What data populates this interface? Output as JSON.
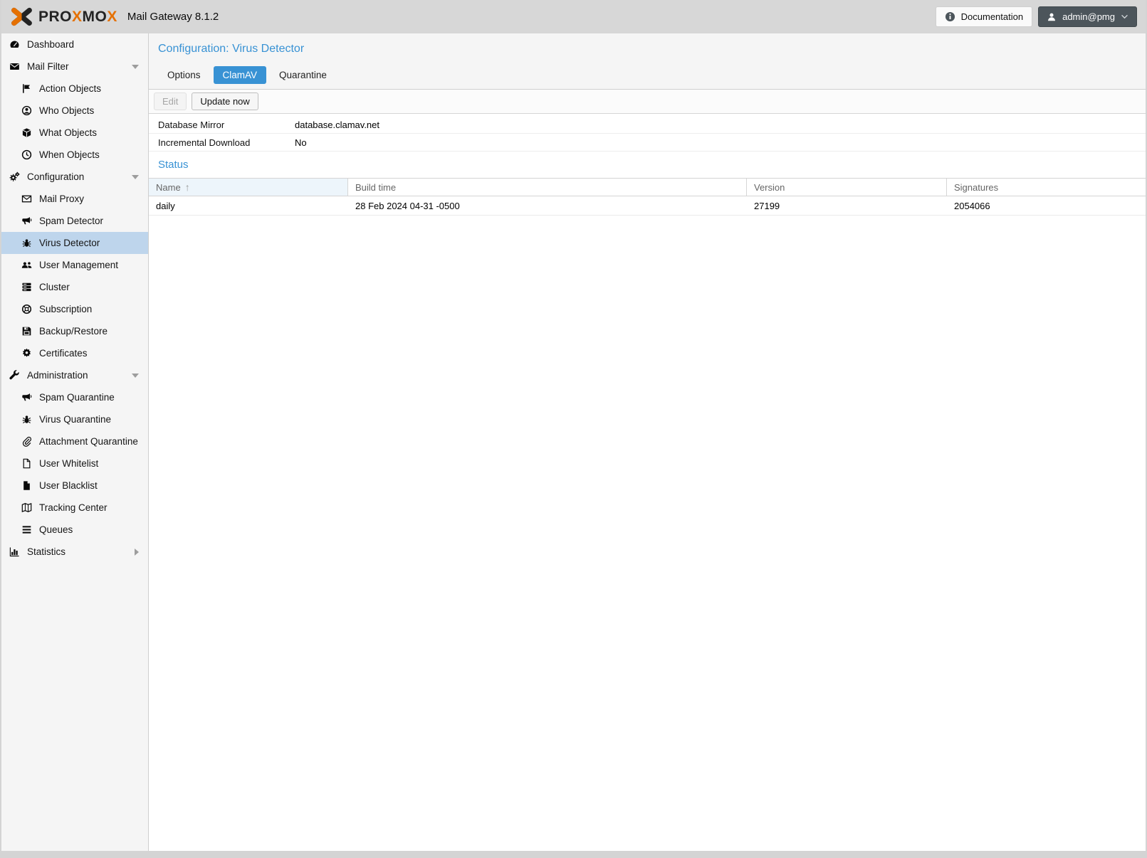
{
  "header": {
    "logo_segments": [
      {
        "text": "PRO",
        "color": "dark"
      },
      {
        "text": "X",
        "color": "orange"
      },
      {
        "text": "MO",
        "color": "dark"
      },
      {
        "text": "X",
        "color": "orange"
      }
    ],
    "app_title": "Mail Gateway 8.1.2",
    "documentation_label": "Documentation",
    "user_label": "admin@pmg"
  },
  "sidebar": {
    "items": [
      {
        "label": "Dashboard",
        "icon": "dashboard-icon",
        "level": 0,
        "caret": "",
        "selected": false
      },
      {
        "label": "Mail Filter",
        "icon": "mail-icon",
        "level": 0,
        "caret": "down",
        "selected": false
      },
      {
        "label": "Action Objects",
        "icon": "flag-icon",
        "level": 1,
        "caret": "",
        "selected": false
      },
      {
        "label": "Who Objects",
        "icon": "user-circle-icon",
        "level": 1,
        "caret": "",
        "selected": false
      },
      {
        "label": "What Objects",
        "icon": "cube-icon",
        "level": 1,
        "caret": "",
        "selected": false
      },
      {
        "label": "When Objects",
        "icon": "clock-icon",
        "level": 1,
        "caret": "",
        "selected": false
      },
      {
        "label": "Configuration",
        "icon": "gears-icon",
        "level": 0,
        "caret": "down",
        "selected": false
      },
      {
        "label": "Mail Proxy",
        "icon": "envelope-open-icon",
        "level": 1,
        "caret": "",
        "selected": false
      },
      {
        "label": "Spam Detector",
        "icon": "bullhorn-icon",
        "level": 1,
        "caret": "",
        "selected": false
      },
      {
        "label": "Virus Detector",
        "icon": "bug-icon",
        "level": 1,
        "caret": "",
        "selected": true
      },
      {
        "label": "User Management",
        "icon": "users-icon",
        "level": 1,
        "caret": "",
        "selected": false
      },
      {
        "label": "Cluster",
        "icon": "server-icon",
        "level": 1,
        "caret": "",
        "selected": false
      },
      {
        "label": "Subscription",
        "icon": "life-ring-icon",
        "level": 1,
        "caret": "",
        "selected": false
      },
      {
        "label": "Backup/Restore",
        "icon": "save-icon",
        "level": 1,
        "caret": "",
        "selected": false
      },
      {
        "label": "Certificates",
        "icon": "certificate-icon",
        "level": 1,
        "caret": "",
        "selected": false
      },
      {
        "label": "Administration",
        "icon": "wrench-icon",
        "level": 0,
        "caret": "down",
        "selected": false
      },
      {
        "label": "Spam Quarantine",
        "icon": "bullhorn-icon",
        "level": 1,
        "caret": "",
        "selected": false
      },
      {
        "label": "Virus Quarantine",
        "icon": "bug-icon",
        "level": 1,
        "caret": "",
        "selected": false
      },
      {
        "label": "Attachment Quarantine",
        "icon": "paperclip-icon",
        "level": 1,
        "caret": "",
        "selected": false
      },
      {
        "label": "User Whitelist",
        "icon": "file-outline-icon",
        "level": 1,
        "caret": "",
        "selected": false
      },
      {
        "label": "User Blacklist",
        "icon": "file-solid-icon",
        "level": 1,
        "caret": "",
        "selected": false
      },
      {
        "label": "Tracking Center",
        "icon": "map-icon",
        "level": 1,
        "caret": "",
        "selected": false
      },
      {
        "label": "Queues",
        "icon": "bars-icon",
        "level": 1,
        "caret": "",
        "selected": false
      },
      {
        "label": "Statistics",
        "icon": "chart-icon",
        "level": 0,
        "caret": "right",
        "selected": false
      }
    ]
  },
  "main": {
    "page_title": "Configuration: Virus Detector",
    "tabs": [
      {
        "label": "Options",
        "active": false
      },
      {
        "label": "ClamAV",
        "active": true
      },
      {
        "label": "Quarantine",
        "active": false
      }
    ],
    "toolbar": {
      "edit_label": "Edit",
      "edit_disabled": true,
      "update_label": "Update now"
    },
    "properties": [
      {
        "label": "Database Mirror",
        "value": "database.clamav.net"
      },
      {
        "label": "Incremental Download",
        "value": "No"
      }
    ],
    "status_heading": "Status",
    "table": {
      "columns": [
        "Name",
        "Build time",
        "Version",
        "Signatures"
      ],
      "sorted_column": "Name",
      "sort_direction": "asc",
      "rows": [
        [
          "daily",
          "28 Feb 2024 04-31 -0500",
          "27199",
          "2054066"
        ]
      ]
    }
  },
  "colors": {
    "accent": "#3892d4",
    "brand_orange": "#e57000",
    "selected_sidebar_bg": "#bed5ec",
    "topbar_bg": "#d7d7d7",
    "user_button_bg": "#4c555b",
    "sorted_header_bg": "#edf5fb"
  }
}
